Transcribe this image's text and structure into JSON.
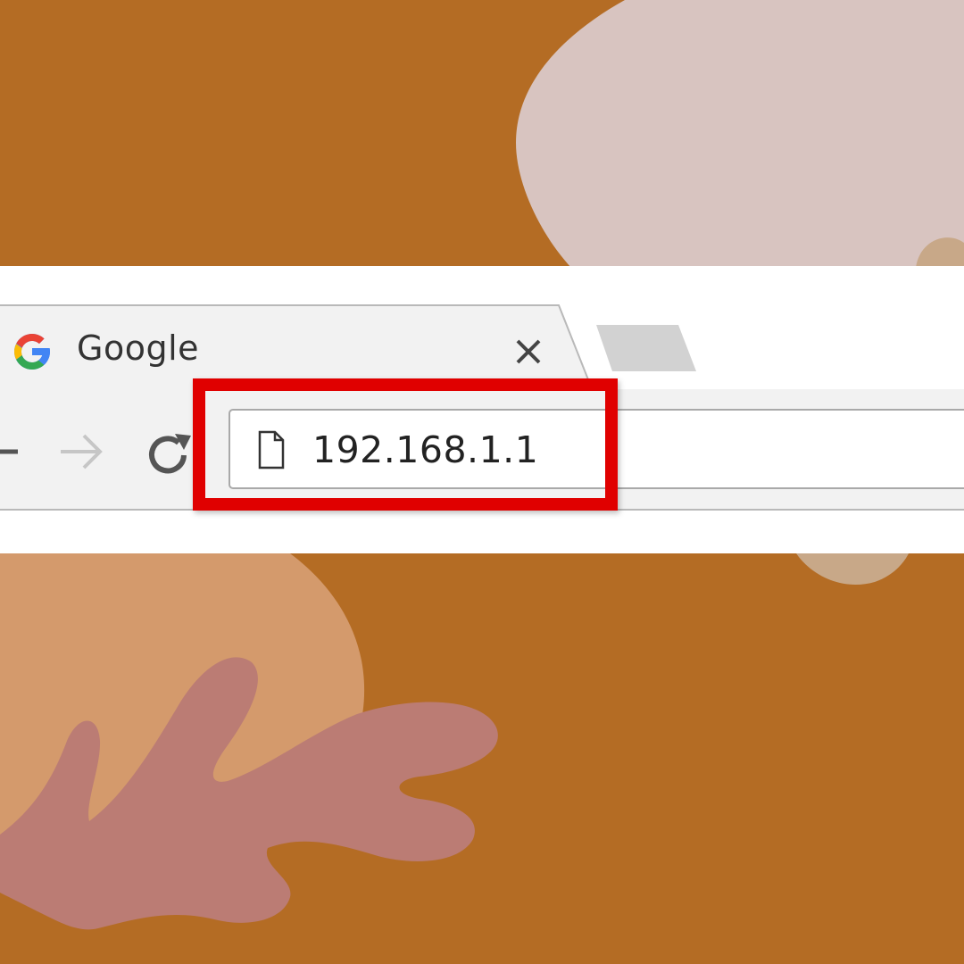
{
  "colors": {
    "background": "#b46c24",
    "strip": "#ffffff",
    "highlight": "#e00000",
    "blob_pink": "#d8c4c0",
    "blob_tan": "#d49a6c",
    "blob_rose": "#bb7c74",
    "blob_beige": "#c8a888"
  },
  "browser": {
    "tab": {
      "title": "Google",
      "favicon": "google-g-icon",
      "close_icon": "close-icon"
    },
    "new_tab_icon": "new-tab-icon",
    "nav": {
      "back_icon": "back-arrow-icon",
      "forward_icon": "forward-arrow-icon",
      "reload_icon": "reload-icon"
    },
    "address_bar": {
      "page_icon": "page-icon",
      "url": "192.168.1.1"
    }
  }
}
